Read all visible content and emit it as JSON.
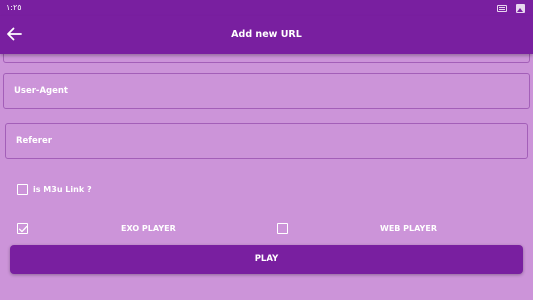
{
  "status_bar": {
    "time": "١:٢٥",
    "icons": [
      "keyboard-icon",
      "image-icon"
    ]
  },
  "app_bar": {
    "title": "Add new URL",
    "back_icon": "arrow-left-icon"
  },
  "form": {
    "user_agent_placeholder": "User-Agent",
    "referer_placeholder": "Referer"
  },
  "options": {
    "m3u_label": "is M3u Link ?",
    "m3u_checked": false,
    "exo_label": "EXO PLAYER",
    "exo_checked": true,
    "web_label": "WEB PLAYER",
    "web_checked": false
  },
  "play_label": "PLAY",
  "colors": {
    "primary": "#791fa0",
    "background": "#cc94d9",
    "text": "#ffffff",
    "border": "#a35fb8"
  }
}
